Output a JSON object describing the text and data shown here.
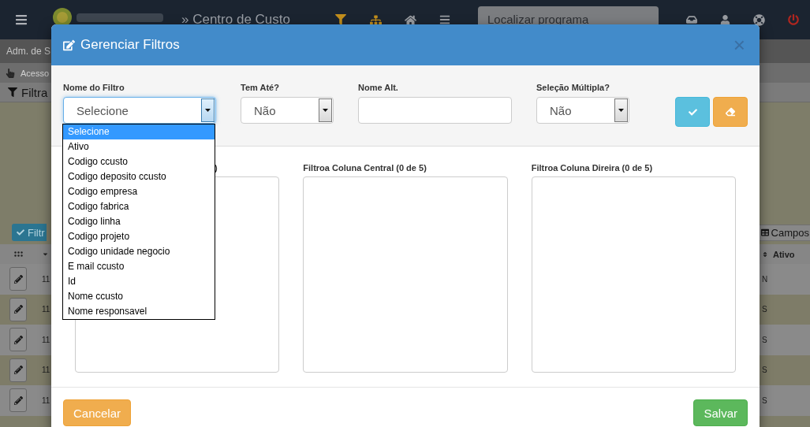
{
  "navbar": {
    "breadcrumb": "» Centro de Custo",
    "search": {
      "placeholder": "Localizar programa"
    }
  },
  "subbar": {
    "title": "Adm. de S"
  },
  "access_bar": {
    "label": "Acesso"
  },
  "panel": {
    "title": "Filtra",
    "filter_button": "Filtr",
    "fields_button": "Campos"
  },
  "table": {
    "columns": [
      {
        "label": "Ativo"
      }
    ],
    "rows": [
      {
        "column_2": "11",
        "ativo": "N"
      },
      {
        "column_2": "11",
        "ativo": "S"
      },
      {
        "column_2": "11",
        "ativo": "S"
      },
      {
        "column_2": "11",
        "ativo": "S"
      },
      {
        "column_2": "11",
        "ativo": "S"
      }
    ]
  },
  "modal": {
    "title": "Gerenciar Filtros",
    "close": "×",
    "fields": [
      {
        "kind": "select",
        "label": "Nome do Filtro",
        "value": "Selecione",
        "open": true,
        "options": [
          {
            "label": "Selecione",
            "selected": true
          },
          {
            "label": "Ativo",
            "selected": false
          },
          {
            "label": "Codigo ccusto",
            "selected": false
          },
          {
            "label": "Codigo deposito ccusto",
            "selected": false
          },
          {
            "label": "Codigo empresa",
            "selected": false
          },
          {
            "label": "Codigo fabrica",
            "selected": false
          },
          {
            "label": "Codigo linha",
            "selected": false
          },
          {
            "label": "Codigo projeto",
            "selected": false
          },
          {
            "label": "Codigo unidade negocio",
            "selected": false
          },
          {
            "label": "E mail ccusto",
            "selected": false
          },
          {
            "label": "Id",
            "selected": false
          },
          {
            "label": "Nome ccusto",
            "selected": false
          },
          {
            "label": "Nome responsavel",
            "selected": false
          }
        ]
      },
      {
        "kind": "select",
        "label": "Tem Até?",
        "value": "Não",
        "open": false
      },
      {
        "kind": "input",
        "label": "Nome Alt."
      },
      {
        "kind": "select",
        "label": "Seleção Múltipla?",
        "value": "Não",
        "open": false
      }
    ],
    "columns": [
      {
        "label": ")"
      },
      {
        "label": "Filtroa Coluna Central (0 de 5)"
      },
      {
        "label": "Filtroa Coluna Direira (0 de 5)"
      }
    ],
    "footer_buttons": [
      {
        "kind": "cancel",
        "label": "Cancelar"
      },
      {
        "kind": "save",
        "label": "Salvar"
      }
    ]
  }
}
